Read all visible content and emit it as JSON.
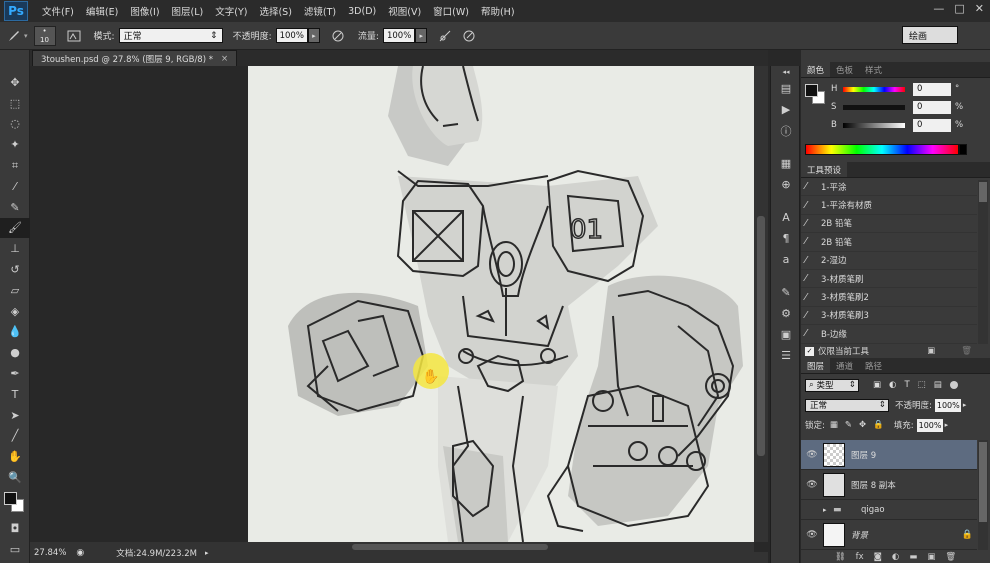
{
  "menu": {
    "logo": "Ps",
    "items": [
      "文件(F)",
      "编辑(E)",
      "图像(I)",
      "图层(L)",
      "文字(Y)",
      "选择(S)",
      "滤镜(T)",
      "3D(D)",
      "视图(V)",
      "窗口(W)",
      "帮助(H)"
    ],
    "window_controls": [
      "—",
      "□",
      "✕"
    ]
  },
  "options": {
    "brush_size": "10",
    "mode_label": "模式:",
    "mode_value": "正常",
    "opacity_label": "不透明度:",
    "opacity_value": "100%",
    "flow_label": "流量:",
    "flow_value": "100%",
    "workspace": "绘画"
  },
  "document": {
    "tab_title": "3toushen.psd @ 27.8% (图层 9, RGB/8) *",
    "close": "×"
  },
  "status": {
    "zoom": "27.84%",
    "doc_info": "文档:24.9M/223.2M"
  },
  "color_panel": {
    "tabs": [
      "颜色",
      "色板",
      "样式"
    ],
    "h_label": "H",
    "h_value": "0",
    "h_unit": "°",
    "s_label": "S",
    "s_value": "0",
    "s_unit": "%",
    "b_label": "B",
    "b_value": "0",
    "b_unit": "%",
    "foreground": "#111111",
    "background": "#ffffff"
  },
  "presets_panel": {
    "title": "工具预设",
    "items": [
      "1-平涂",
      "1-平涂有材质",
      "2B 铅笔",
      "2B 铅笔",
      "2-湿边",
      "3-材质笔刷",
      "3-材质笔刷2",
      "3-材质笔刷3",
      "B-边缘"
    ],
    "current_only": "仅限当前工具"
  },
  "layers_panel": {
    "tabs": [
      "图层",
      "通道",
      "路径"
    ],
    "filter_label": "类型",
    "blend_mode": "正常",
    "opacity_label": "不透明度:",
    "opacity_value": "100%",
    "lock_label": "锁定:",
    "fill_label": "填充:",
    "fill_value": "100%",
    "layers": [
      {
        "name": "图层 9",
        "visible": true,
        "selected": true
      },
      {
        "name": "图层 8 副本",
        "visible": true,
        "selected": false
      },
      {
        "name": "qigao",
        "visible": false,
        "selected": false,
        "group": true
      },
      {
        "name": "背景",
        "visible": true,
        "selected": false,
        "locked": true
      }
    ]
  }
}
